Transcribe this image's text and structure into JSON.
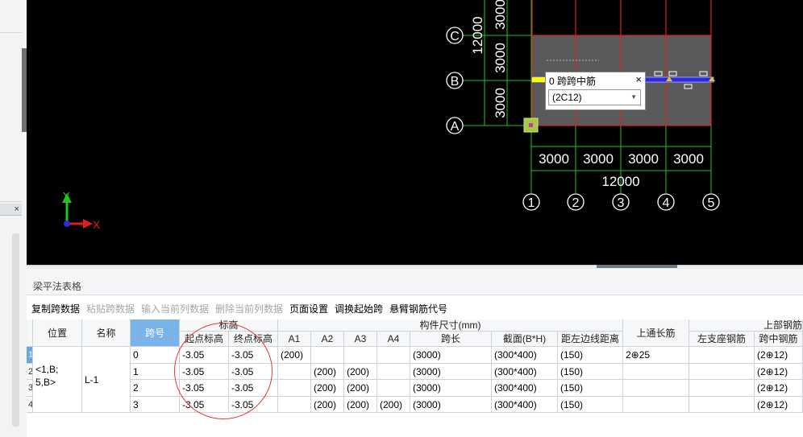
{
  "drawing": {
    "row_axes": [
      "C",
      "B",
      "A"
    ],
    "col_axes": [
      "1",
      "2",
      "3",
      "4",
      "5"
    ],
    "left_dims": [
      "3000",
      "12000",
      "3000",
      "3000"
    ],
    "bottom_dims": [
      "3000",
      "3000",
      "3000",
      "3000"
    ],
    "total_dim": "12000",
    "ucs_y": "Y",
    "ucs_x": "X"
  },
  "popup": {
    "title": "0 跨跨中筋",
    "close": "×",
    "value": "(2C12)"
  },
  "panel": {
    "title": "梁平法表格"
  },
  "toolbar": {
    "copy": "复制跨数据",
    "paste": "粘贴跨数据",
    "input_col": "输入当前列数据",
    "delete_col": "删除当前列数据",
    "page_setup": "页面设置",
    "swap_start": "调换起始跨",
    "cantilever": "悬臂钢筋代号"
  },
  "table": {
    "headers": {
      "position": "位置",
      "name": "名称",
      "span": "跨号",
      "elevation": "标高",
      "start_elev": "起点标高",
      "end_elev": "终点标高",
      "dims": "构件尺寸(mm)",
      "a1": "A1",
      "a2": "A2",
      "a3": "A3",
      "a4": "A4",
      "span_len": "跨长",
      "section": "截面(B*H)",
      "edge_dist": "距左边线距离",
      "through": "上通长筋",
      "top_steel": "上部钢筋",
      "left_support": "左支座钢筋",
      "mid_span": "跨中钢筋"
    },
    "row_numbers": [
      "1",
      "2",
      "3",
      "4"
    ],
    "position": "<1,B;\n5,B>",
    "name": "L-1",
    "rows": [
      {
        "span": "0",
        "start": "-3.05",
        "end": "-3.05",
        "a1": "(200)",
        "a2": "",
        "a3": "",
        "a4": "",
        "len": "(3000)",
        "sec": "(300*400)",
        "dist": "(150)",
        "through": "2⊕25",
        "left": "",
        "mid": "(2⊕12)"
      },
      {
        "span": "1",
        "start": "-3.05",
        "end": "-3.05",
        "a1": "",
        "a2": "(200)",
        "a3": "(200)",
        "a4": "",
        "len": "(3000)",
        "sec": "(300*400)",
        "dist": "(150)",
        "through": "",
        "left": "",
        "mid": "(2⊕12)"
      },
      {
        "span": "2",
        "start": "-3.05",
        "end": "-3.05",
        "a1": "",
        "a2": "(200)",
        "a3": "(200)",
        "a4": "",
        "len": "(3000)",
        "sec": "(300*400)",
        "dist": "(150)",
        "through": "",
        "left": "",
        "mid": "(2⊕12)"
      },
      {
        "span": "3",
        "start": "-3.05",
        "end": "-3.05",
        "a1": "",
        "a2": "(200)",
        "a3": "(200)",
        "a4": "(200)",
        "len": "(3000)",
        "sec": "(300*400)",
        "dist": "(150)",
        "through": "",
        "left": "",
        "mid": "(2⊕12)"
      }
    ]
  },
  "colors": {
    "axis_green": "#22c322",
    "beam_red": "#e01e1e",
    "slab_fill": "#5a5a5a",
    "selected_beam": "#2a2ae0",
    "highlight_yellow": "#ffff00",
    "annotation_red": "#e53935",
    "selected_header": "#7ab2ea"
  }
}
